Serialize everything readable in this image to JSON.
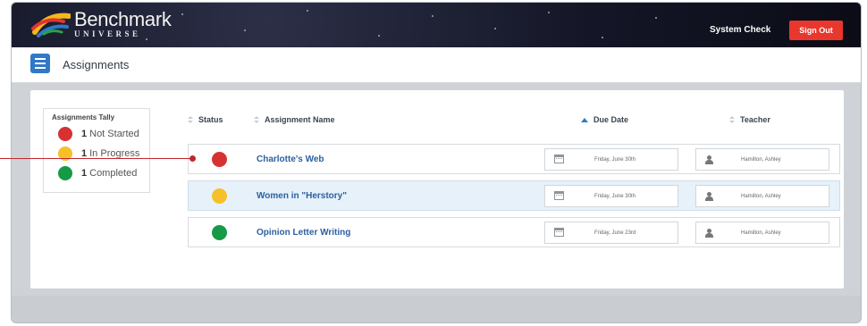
{
  "header": {
    "logo_main": "Benchmark",
    "logo_sub": "UNIVERSE",
    "system_check": "System Check",
    "sign_out": "Sign Out"
  },
  "subheader": {
    "title": "Assignments"
  },
  "tally": {
    "title": "Assignments Tally",
    "items": [
      {
        "count": "1",
        "label": "Not Started",
        "color": "#d73232"
      },
      {
        "count": "1",
        "label": "In Progress",
        "color": "#f6c028"
      },
      {
        "count": "1",
        "label": "Completed",
        "color": "#159a46"
      }
    ]
  },
  "table": {
    "headers": {
      "status": "Status",
      "name": "Assignment Name",
      "due": "Due Date",
      "teacher": "Teacher"
    },
    "rows": [
      {
        "status_color": "#d73232",
        "name": "Charlotte's Web",
        "due": "Friday, June 30th",
        "teacher": "Hamilton, Ashley"
      },
      {
        "status_color": "#f6c028",
        "name": "Women in \"Herstory\"",
        "due": "Friday, June 30th",
        "teacher": "Hamilton, Ashley"
      },
      {
        "status_color": "#159a46",
        "name": "Opinion Letter Writing",
        "due": "Friday, June 23rd",
        "teacher": "Hamilton, Ashley"
      }
    ]
  },
  "colors": {
    "accent": "#2f79c6",
    "sign_out": "#e8372d",
    "callout": "#c0272d"
  }
}
